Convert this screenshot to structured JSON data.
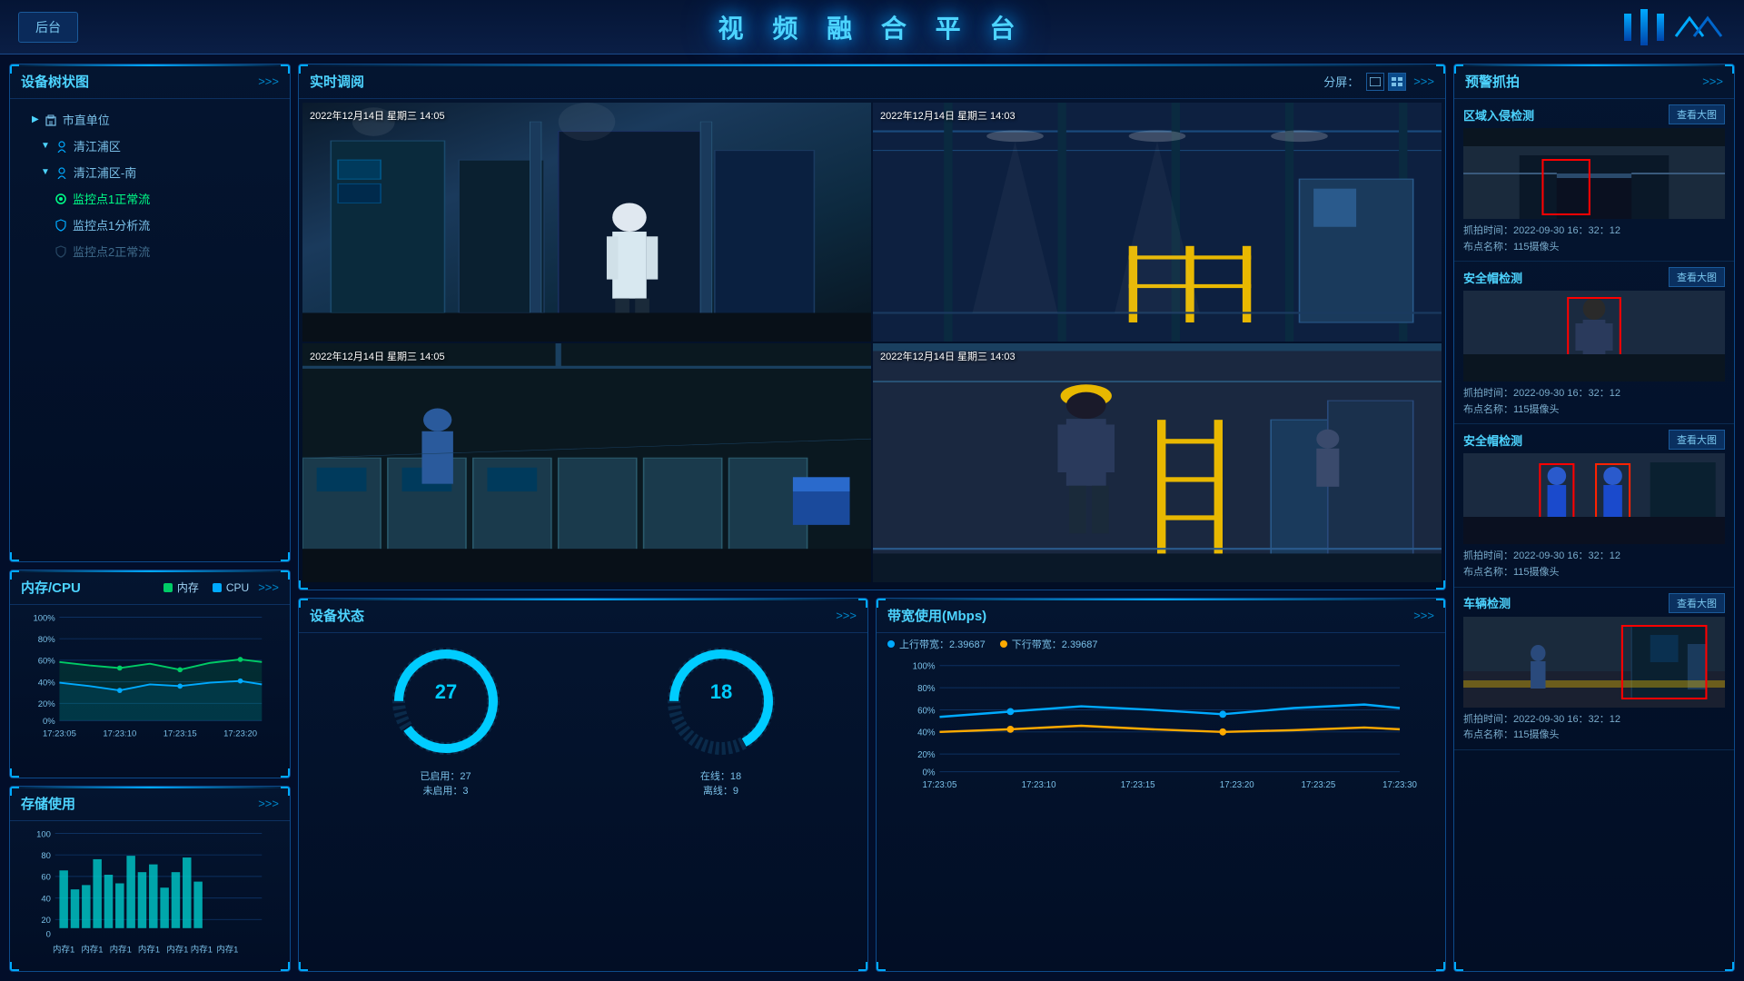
{
  "header": {
    "title": "视 频 融 合 平 台",
    "back_label": "后台"
  },
  "device_tree": {
    "title": "设备树状图",
    "more": ">>>",
    "items": [
      {
        "label": "市直单位",
        "level": 1,
        "icon": "city",
        "expanded": false
      },
      {
        "label": "清江浦区",
        "level": 1,
        "icon": "region",
        "expanded": true
      },
      {
        "label": "清江浦区-南",
        "level": 2,
        "icon": "sub-region",
        "expanded": true
      },
      {
        "label": "监控点1正常流",
        "level": 3,
        "icon": "camera-active",
        "status": "active"
      },
      {
        "label": "监控点1分析流",
        "level": 3,
        "icon": "camera-shield",
        "status": "normal"
      },
      {
        "label": "监控点2正常流",
        "level": 3,
        "icon": "camera-dim",
        "status": "dim"
      }
    ]
  },
  "cpu_memory": {
    "title": "内存/CPU",
    "more": ">>>",
    "legend": {
      "memory_label": "内存",
      "cpu_label": "CPU",
      "memory_color": "#00cc66",
      "cpu_color": "#00aaff"
    },
    "x_labels": [
      "17:23:05",
      "17:23:10",
      "17:23:15",
      "17:23:20"
    ],
    "y_labels": [
      "100%",
      "80%",
      "60%",
      "40%",
      "20%",
      "0%"
    ],
    "memory_values": [
      65,
      60,
      58,
      62,
      56,
      64,
      68,
      65
    ],
    "cpu_values": [
      42,
      38,
      35,
      40,
      38,
      42,
      44,
      40
    ]
  },
  "storage": {
    "title": "存储使用",
    "more": ">>>",
    "y_labels": [
      "100",
      "80",
      "60",
      "40",
      "20",
      "0"
    ],
    "x_labels": [
      "内存1",
      "内存1",
      "内存1",
      "内存1",
      "内存1",
      "内存1",
      "内存1"
    ],
    "bars": [
      55,
      30,
      35,
      65,
      50,
      40,
      75,
      45,
      60,
      35,
      55,
      70,
      40
    ]
  },
  "realtime": {
    "title": "实时调阅",
    "more": ">>>",
    "split_label": "分屏：",
    "cameras": [
      {
        "timestamp": "2022年12月14日 星期三 14:05",
        "id": 1
      },
      {
        "timestamp": "2022年12月14日 星期三 14:03",
        "id": 2
      },
      {
        "timestamp": "2022年12月14日 星期三 14:05",
        "id": 3
      },
      {
        "timestamp": "2022年12月14日 星期三 14:03",
        "id": 4
      }
    ]
  },
  "device_status": {
    "title": "设备状态",
    "more": ">>>",
    "enabled": {
      "value": 27,
      "label": "已启用：27"
    },
    "not_enabled": {
      "value": 3,
      "label": "未启用：3"
    },
    "online": {
      "value": 18,
      "label": "在线：18"
    },
    "offline": {
      "value": 9,
      "label": "离线：9"
    }
  },
  "bandwidth": {
    "title": "带宽使用(Mbps)",
    "more": ">>>",
    "x_labels": [
      "17:23:05",
      "17:23:10",
      "17:23:15",
      "17:23:20",
      "17:23:25",
      "17:23:30"
    ],
    "y_labels": [
      "100%",
      "80%",
      "60%",
      "40%",
      "20%",
      "0%"
    ],
    "upload_label": "上行带宽：2.39687",
    "download_label": "下行带宽：2.39687",
    "upload_color": "#00aaff",
    "download_color": "#ffaa00",
    "upload_values": [
      45,
      50,
      55,
      52,
      48,
      53,
      58,
      55
    ],
    "download_values": [
      40,
      42,
      44,
      42,
      40,
      41,
      43,
      42
    ]
  },
  "warnings": {
    "title": "预警抓拍",
    "more": ">>>",
    "items": [
      {
        "type": "区域入侵检测",
        "view_label": "查看大图",
        "capture_time": "抓拍时间：2022-09-30 16：32：12",
        "location": "布点名称：115摄像头"
      },
      {
        "type": "安全帽检测",
        "view_label": "查看大图",
        "capture_time": "抓拍时间：2022-09-30 16：32：12",
        "location": "布点名称：115摄像头"
      },
      {
        "type": "安全帽检测",
        "view_label": "查看大图",
        "capture_time": "抓拍时间：2022-09-30 16：32：12",
        "location": "布点名称：115摄像头"
      },
      {
        "type": "车辆检测",
        "view_label": "查看大图",
        "capture_time": "抓拍时间：2022-09-30 16：32：12",
        "location": "布点名称：115摄像头"
      }
    ]
  }
}
